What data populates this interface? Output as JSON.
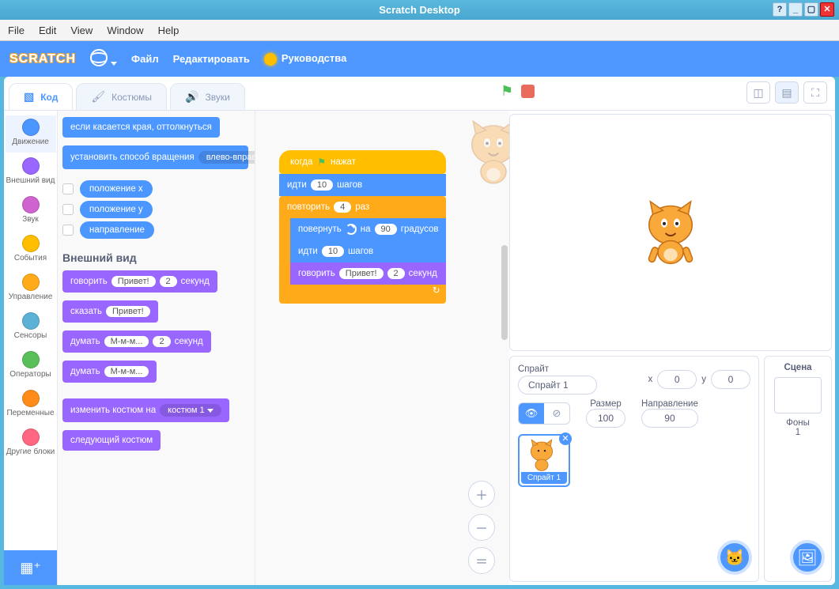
{
  "window": {
    "title": "Scratch Desktop"
  },
  "menubar": {
    "file": "File",
    "edit": "Edit",
    "view": "View",
    "window": "Window",
    "help": "Help"
  },
  "scratchbar": {
    "logo": "SCRATCH",
    "file": "Файл",
    "edit": "Редактировать",
    "tutorials": "Руководства"
  },
  "tabs": {
    "code": "Код",
    "costumes": "Костюмы",
    "sounds": "Звуки"
  },
  "categories": [
    {
      "label": "Движение",
      "color": "#4c97ff",
      "sel": true
    },
    {
      "label": "Внешний вид",
      "color": "#9966ff"
    },
    {
      "label": "Звук",
      "color": "#cf63cf"
    },
    {
      "label": "События",
      "color": "#ffbf00"
    },
    {
      "label": "Управление",
      "color": "#ffab19"
    },
    {
      "label": "Сенсоры",
      "color": "#5cb1d6"
    },
    {
      "label": "Операторы",
      "color": "#59c059"
    },
    {
      "label": "Переменные",
      "color": "#ff8c1a"
    },
    {
      "label": "Другие блоки",
      "color": "#ff6680"
    }
  ],
  "palette": {
    "motion": {
      "bounce": "если касается края, оттолкнуться",
      "setrot_pre": "установить способ вращения",
      "setrot_val": "влево-вправо",
      "xpos": "положение x",
      "ypos": "положение y",
      "dir": "направление"
    },
    "looks_header": "Внешний вид",
    "looks": {
      "sayfor_pre": "говорить",
      "sayfor_val": "Привет!",
      "sayfor_num": "2",
      "sayfor_post": "секунд",
      "say_pre": "сказать",
      "say_val": "Привет!",
      "thinkfor_pre": "думать",
      "thinkfor_val": "М-м-м...",
      "thinkfor_num": "2",
      "thinkfor_post": "секунд",
      "think_pre": "думать",
      "think_val": "М-м-м...",
      "switch_pre": "изменить костюм на",
      "switch_val": "костюм 1",
      "next": "следующий костюм"
    }
  },
  "script": {
    "hat_pre": "когда",
    "hat_post": "нажат",
    "move_pre": "идти",
    "move_val": "10",
    "move_post": "шагов",
    "repeat_pre": "повторить",
    "repeat_val": "4",
    "repeat_post": "раз",
    "turn_pre": "повернуть",
    "turn_mid": "на",
    "turn_val": "90",
    "turn_post": "градусов",
    "move2_pre": "идти",
    "move2_val": "10",
    "move2_post": "шагов",
    "say_pre": "говорить",
    "say_val": "Привет!",
    "say_num": "2",
    "say_post": "секунд"
  },
  "spritepane": {
    "sprite_lbl": "Спрайт",
    "sprite_name": "Спрайт 1",
    "x_lbl": "x",
    "x_val": "0",
    "y_lbl": "y",
    "y_val": "0",
    "size_lbl": "Размер",
    "size_val": "100",
    "dir_lbl": "Направление",
    "dir_val": "90",
    "thumb_label": "Спрайт 1"
  },
  "scenepane": {
    "title": "Сцена",
    "backdrops_lbl": "Фоны",
    "backdrops_n": "1"
  }
}
